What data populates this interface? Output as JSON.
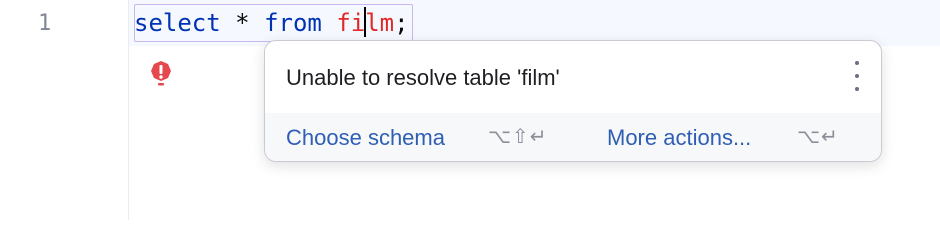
{
  "editor": {
    "line_number": "1",
    "code": {
      "keyword_select": "select",
      "star": " * ",
      "keyword_from": "from",
      "space": " ",
      "error_token_before_caret": "fi",
      "error_token_after_caret": "lm",
      "semicolon": ";"
    },
    "gutter_icon": "error-exclamation-icon"
  },
  "popup": {
    "message": "Unable to resolve table 'film'",
    "menu_icon": "more-vertical-icon",
    "actions": [
      {
        "label": "Choose schema",
        "shortcut": "⌥⇧↵"
      },
      {
        "label": "More actions...",
        "shortcut": "⌥↵"
      }
    ]
  },
  "colors": {
    "keyword": "#0033b3",
    "error": "#e02a2a",
    "link": "#2f5eb5"
  }
}
